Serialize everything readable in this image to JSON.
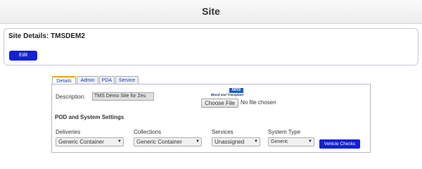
{
  "header": {
    "title": "Site"
  },
  "site_panel": {
    "title": "Site Details: TMSDEM2",
    "edit_label": "Edit"
  },
  "tabs": [
    {
      "label": "Details",
      "active": true
    },
    {
      "label": "Admin",
      "active": false
    },
    {
      "label": "PDA",
      "active": false
    },
    {
      "label": "Service",
      "active": false
    }
  ],
  "details": {
    "description_label": "Description:",
    "description_value": "TMS Demo Site for Zeu",
    "logo_badge": "NHS",
    "logo_text": "Blood and Transplant",
    "choose_file_label": "Choose File",
    "file_status": "No file chosen",
    "section_heading": "POD and System Settings",
    "deliveries_label": "Deliveries",
    "deliveries_value": "Generic Container",
    "collections_label": "Collections",
    "collections_value": "Generic Container",
    "services_label": "Services",
    "services_value": "Unassigned",
    "system_type_label": "System Type",
    "system_type_value": "Generic",
    "vehicle_checks_label": "Vehicle Checks"
  },
  "colors": {
    "button_blue": "#1220d8",
    "tab_accent": "#f0a020",
    "nhs_blue": "#1a5fbf"
  }
}
